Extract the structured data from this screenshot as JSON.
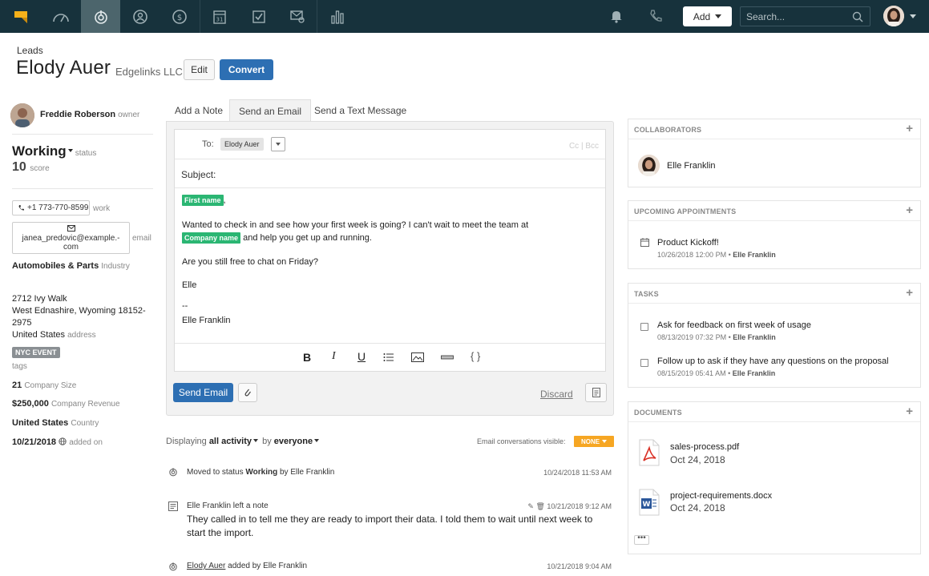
{
  "nav": {
    "items": [
      "logo-icon",
      "dashboard-icon",
      "leads-icon",
      "contacts-icon",
      "deals-icon",
      "calendar-icon",
      "tasks-icon",
      "messages-icon",
      "reports-icon"
    ],
    "calendar_day": "31",
    "add_label": "Add",
    "search_placeholder": "Search..."
  },
  "header": {
    "breadcrumb": "Leads",
    "name": "Elody Auer",
    "company": "Edgelinks LLC",
    "edit_label": "Edit",
    "convert_label": "Convert"
  },
  "lead": {
    "owner_name": "Freddie Roberson",
    "owner_label": "owner",
    "status": "Working",
    "status_label": "status",
    "score": "10",
    "score_label": "score",
    "phone": "+1 773-770-8599",
    "phone_label": "work",
    "email_line1": "janea_predovic@example.-",
    "email_line2": "com",
    "email_label": "email",
    "industry": "Automobiles & Parts",
    "industry_label": "Industry",
    "address_line1": "2712 Ivy Walk",
    "address_line2": "West Ednashire, Wyoming 18152-",
    "address_line3": "2975",
    "address_line4": "United States",
    "address_label": "address",
    "tag": "NYC EVENT",
    "tags_label": "tags",
    "company_size": "21",
    "company_size_label": "Company Size",
    "revenue": "$250,000",
    "revenue_label": "Company Revenue",
    "country": "United States",
    "country_label": "Country",
    "added_on": "10/21/2018",
    "added_on_label": "added on"
  },
  "composer": {
    "tabs": [
      "Add a Note",
      "Send an Email",
      "Send a Text Message"
    ],
    "to_label": "To:",
    "to_chip": "Elody Auer",
    "cc_bcc": "Cc | Bcc",
    "subject_label": "Subject:",
    "token_first_name": "First name",
    "comma": ",",
    "body_line1": "Wanted to check in and see how your first week is going? I can't wait to meet the team at",
    "token_company_name": "Company name",
    "body_line2": "and help you get up and running.",
    "body_line3": "Are you still free to chat on Friday?",
    "body_line4": "Elle",
    "sig_dash": "--",
    "sig_name": "Elle Franklin",
    "toolbar": [
      "bold-icon",
      "italic-icon",
      "underline-icon",
      "list-icon",
      "image-icon",
      "divider-icon",
      "code-icon"
    ],
    "send_label": "Send Email",
    "discard_label": "Discard"
  },
  "activity": {
    "filter_prefix": "Displaying",
    "filter_type": "all activity",
    "filter_by": "by",
    "filter_who": "everyone",
    "email_visible_label": "Email conversations visible:",
    "email_visible_value": "NONE",
    "items": [
      {
        "pre": "Moved to status",
        "bold": "Working",
        "post": "by Elle Franklin",
        "time": "10/24/2018 11:53 AM"
      },
      {
        "pre": "Elle Franklin left a note",
        "bold": "",
        "post": "",
        "time": "10/21/2018 9:12 AM",
        "note": "They called in to tell me they are ready to import their data. I told them to wait until next week to start the import."
      },
      {
        "pre": "Elody Auer",
        "bold": "",
        "post": "added by Elle Franklin",
        "time": "10/21/2018 9:04 AM"
      }
    ]
  },
  "collaborators": {
    "title": "COLLABORATORS",
    "items": [
      "Elle Franklin"
    ]
  },
  "appointments": {
    "title": "UPCOMING APPOINTMENTS",
    "items": [
      {
        "title": "Product Kickoff!",
        "when": "10/26/2018 12:00 PM",
        "who": "Elle Franklin"
      }
    ]
  },
  "tasks": {
    "title": "TASKS",
    "items": [
      {
        "title": "Ask for feedback on first week of usage",
        "when": "08/13/2019 07:32 PM",
        "who": "Elle Franklin"
      },
      {
        "title": "Follow up to ask if they have any questions on the proposal",
        "when": "08/15/2019 05:41 AM",
        "who": "Elle Franklin"
      }
    ]
  },
  "documents": {
    "title": "DOCUMENTS",
    "items": [
      {
        "name": "sales-process.pdf",
        "date": "Oct 24, 2018"
      },
      {
        "name": "project-requirements.docx",
        "date": "Oct 24, 2018"
      }
    ],
    "more_label": "•••"
  },
  "colors": {
    "nav_bg": "#17323c",
    "nav_active": "#4c656c",
    "primary": "#2d6fb3",
    "token_green": "#2bb673",
    "none_orange": "#f6a623",
    "logo_yellow": "#f6b11a"
  }
}
